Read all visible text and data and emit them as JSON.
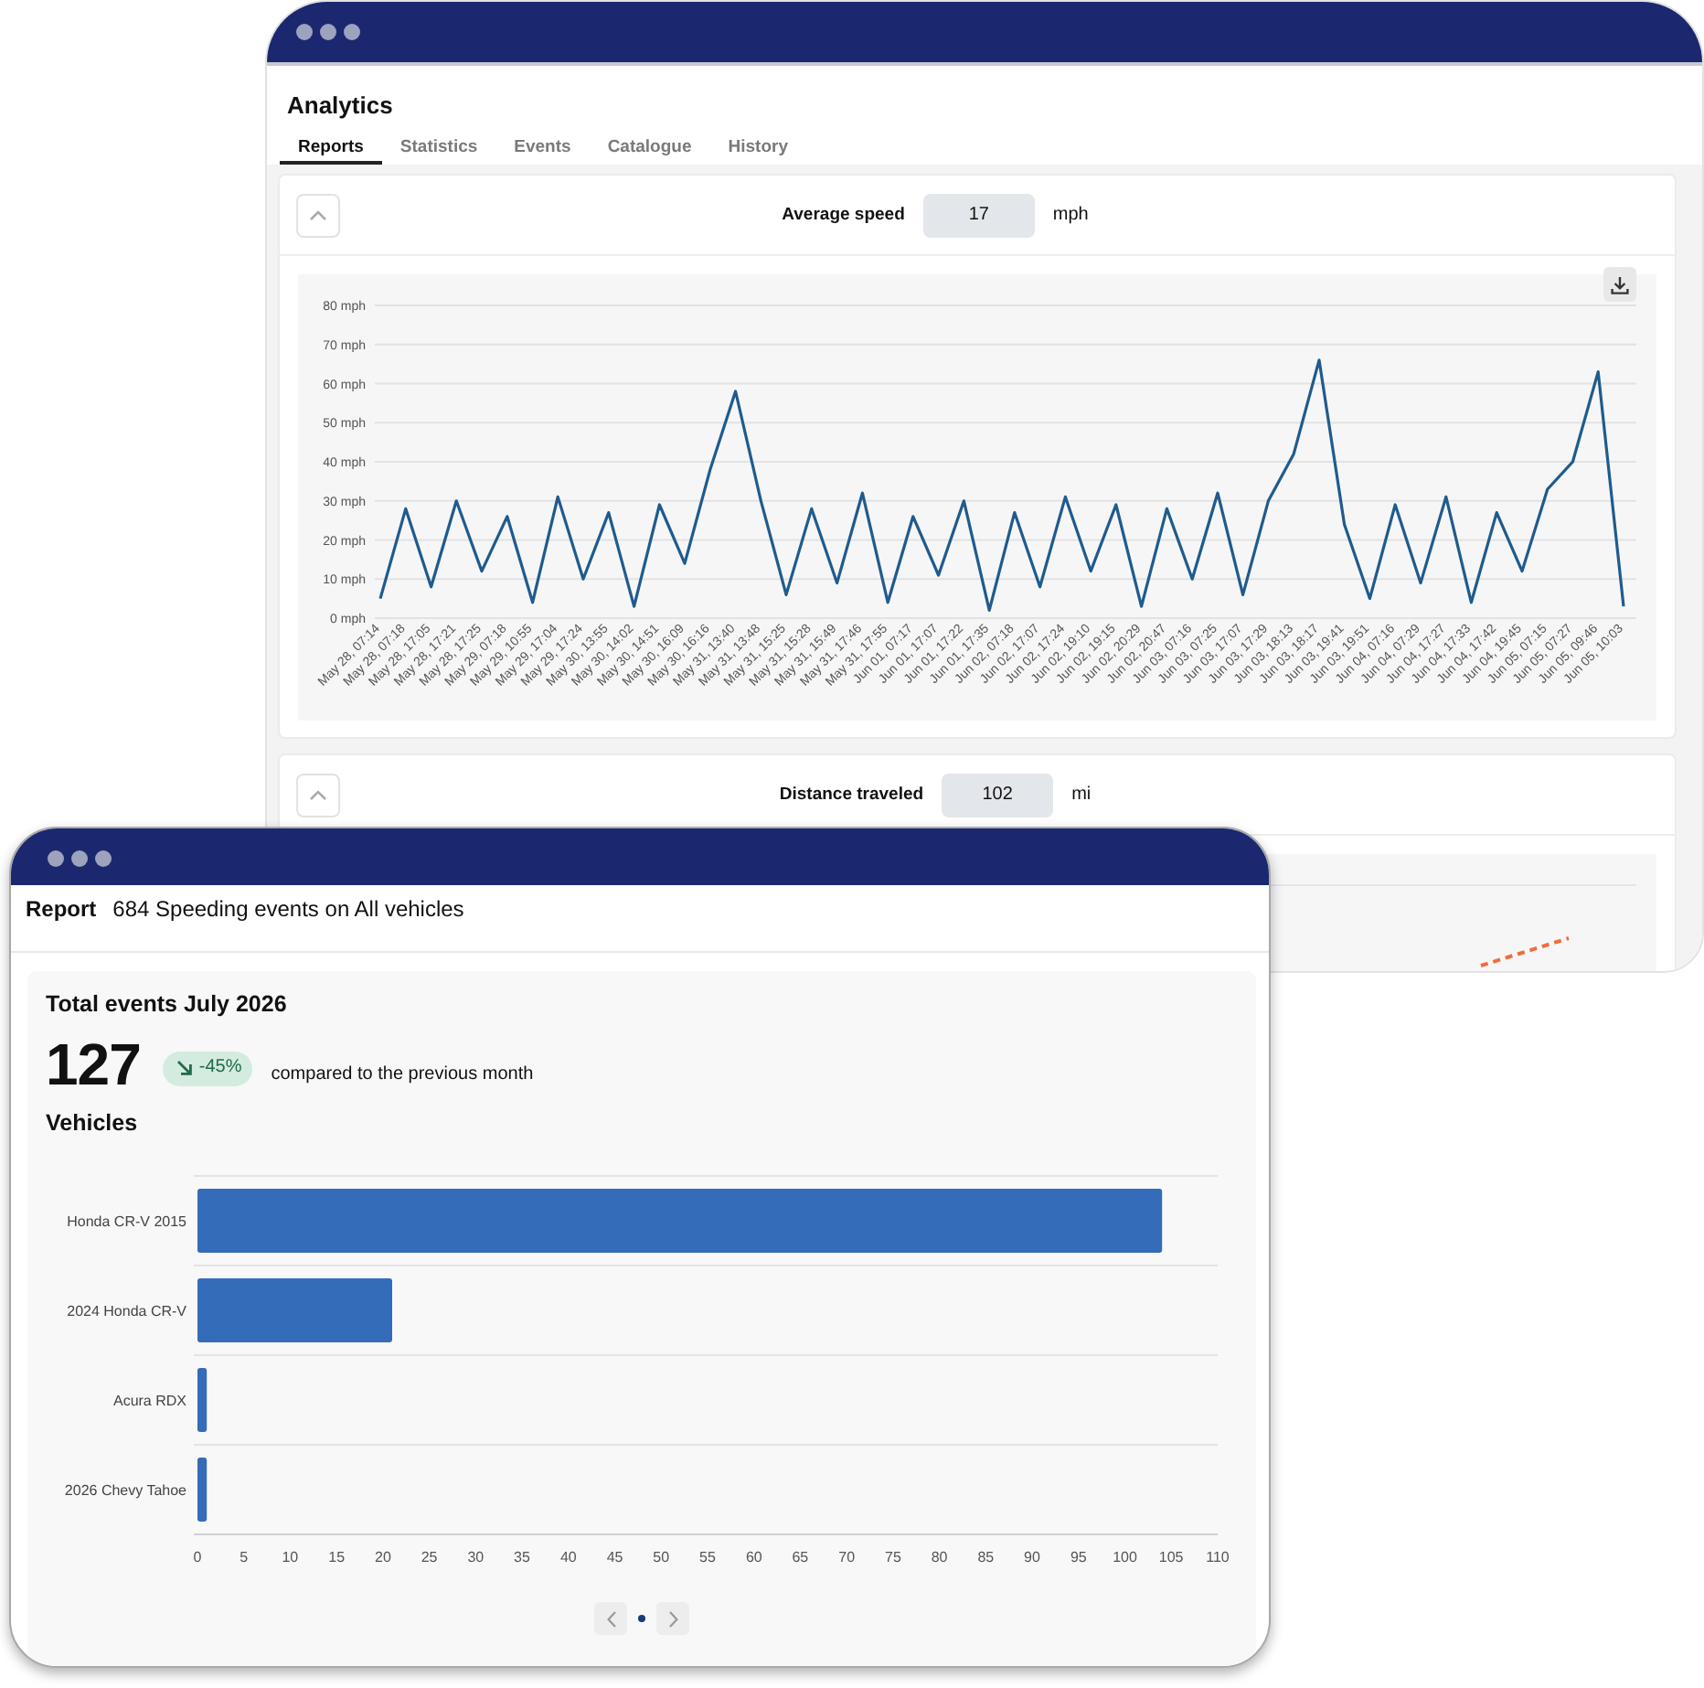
{
  "analytics_window": {
    "title": "Analytics",
    "tabs": [
      {
        "label": "Reports",
        "selected": true
      },
      {
        "label": "Statistics",
        "selected": false
      },
      {
        "label": "Events",
        "selected": false
      },
      {
        "label": "Catalogue",
        "selected": false
      },
      {
        "label": "History",
        "selected": false
      }
    ],
    "cards": [
      {
        "label": "Average speed",
        "value": "17",
        "unit": "mph",
        "expanded": true,
        "chart_data": {
          "type": "line",
          "grid": true,
          "ylim": [
            0,
            80
          ],
          "yticks": [
            {
              "value": 80,
              "label": "80 mph"
            },
            {
              "value": 70,
              "label": "70 mph"
            },
            {
              "value": 60,
              "label": "60 mph"
            },
            {
              "value": 50,
              "label": "50 mph"
            },
            {
              "value": 40,
              "label": "40 mph"
            },
            {
              "value": 30,
              "label": "30 mph"
            },
            {
              "value": 20,
              "label": "20 mph"
            },
            {
              "value": 10,
              "label": "10 mph"
            },
            {
              "value": 0,
              "label": "0 mph"
            }
          ],
          "categories": [
            "May 28, 07:14",
            "May 28, 07:18",
            "May 28, 17:05",
            "May 28, 17:21",
            "May 28, 17:25",
            "May 29, 07:18",
            "May 29, 10:55",
            "May 29, 17:04",
            "May 29, 17:24",
            "May 30, 13:55",
            "May 30, 14:02",
            "May 30, 14:51",
            "May 30, 16:09",
            "May 30, 16:16",
            "May 31, 13:40",
            "May 31, 13:48",
            "May 31, 15:25",
            "May 31, 15:28",
            "May 31, 15:49",
            "May 31, 17:46",
            "May 31, 17:55",
            "Jun 01, 07:17",
            "Jun 01, 17:07",
            "Jun 01, 17:22",
            "Jun 01, 17:35",
            "Jun 02, 07:18",
            "Jun 02, 17:07",
            "Jun 02, 17:24",
            "Jun 02, 19:10",
            "Jun 02, 19:15",
            "Jun 02, 20:29",
            "Jun 02, 20:47",
            "Jun 03, 07:16",
            "Jun 03, 07:25",
            "Jun 03, 17:07",
            "Jun 03, 17:29",
            "Jun 03, 18:13",
            "Jun 03, 18:17",
            "Jun 03, 19:41",
            "Jun 03, 19:51",
            "Jun 04, 07:16",
            "Jun 04, 07:29",
            "Jun 04, 17:27",
            "Jun 04, 17:33",
            "Jun 04, 17:42",
            "Jun 04, 19:45",
            "Jun 05, 07:15",
            "Jun 05, 07:27",
            "Jun 05, 09:46",
            "Jun 05, 10:03"
          ],
          "series": [
            {
              "values": [
                5,
                28,
                8,
                30,
                12,
                26,
                4,
                31,
                10,
                27,
                3,
                29,
                14,
                38,
                58,
                30,
                6,
                28,
                9,
                32,
                4,
                26,
                11,
                30,
                2,
                27,
                8,
                31,
                12,
                29,
                3,
                28,
                10,
                32,
                6,
                30,
                42,
                66,
                24,
                5,
                29,
                9,
                31,
                4,
                27,
                12,
                33,
                40,
                63,
                3
              ]
            }
          ]
        }
      },
      {
        "label": "Distance traveled",
        "value": "102",
        "unit": "mi",
        "expanded": true
      }
    ]
  },
  "report_window": {
    "label": "Report",
    "title": "684 Speeding events on All vehicles",
    "summary": {
      "heading": "Total events July 2026",
      "total": "127",
      "change": "-45%",
      "falling": true,
      "comparison": "compared to the previous month"
    },
    "vehicles": {
      "heading": "Vehicles",
      "chart_data": {
        "type": "bar",
        "orientation": "horizontal",
        "grid": true,
        "categories": [
          "Honda CR-V 2015",
          "2024 Honda CR-V",
          "Acura RDX",
          "2026 Chevy Tahoe"
        ],
        "values": [
          104,
          21,
          1,
          1
        ],
        "xlim": [
          0,
          110
        ],
        "xticks": [
          0,
          5,
          10,
          15,
          20,
          25,
          30,
          35,
          40,
          45,
          50,
          55,
          60,
          65,
          70,
          75,
          80,
          85,
          90,
          95,
          100,
          105,
          110
        ]
      }
    },
    "pagination": {
      "pages": [
        {
          "selected": true
        }
      ]
    }
  }
}
